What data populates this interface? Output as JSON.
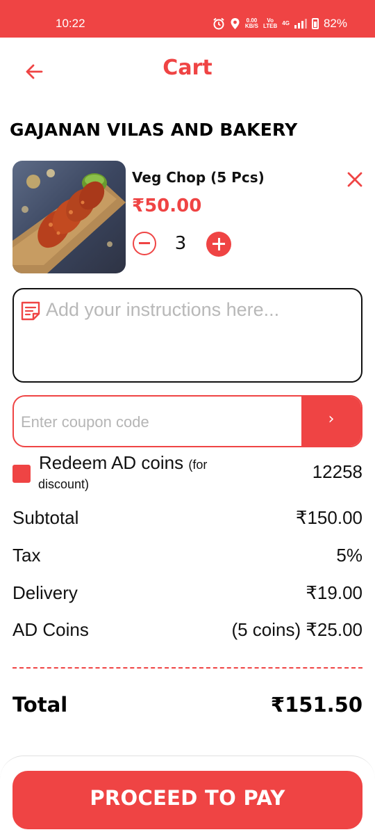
{
  "status_bar": {
    "time": "10:22",
    "net_speed_top": "0.00",
    "net_speed_bottom": "KB/S",
    "volte_top": "Vo",
    "volte_bottom": "LTEB",
    "network": "4G",
    "battery": "82%",
    "icons": [
      "alarm-icon",
      "location-icon",
      "signal-icon",
      "battery-icon"
    ]
  },
  "header": {
    "title": "Cart",
    "back_icon": "arrow-left-icon"
  },
  "restaurant": {
    "name": "GAJANAN VILAS AND BAKERY"
  },
  "cart_item": {
    "name": "Veg Chop (5 Pcs)",
    "price": "₹50.00",
    "quantity": "3",
    "remove_icon": "close-icon",
    "minus_icon": "minus-circle-icon",
    "plus_icon": "plus-circle-icon"
  },
  "instructions": {
    "placeholder": "Add your instructions here...",
    "icon": "note-icon"
  },
  "coupon": {
    "placeholder": "Enter coupon code",
    "button_icon": "chevron-right-icon",
    "button_glyph": "›"
  },
  "redeem": {
    "label": "Redeem AD coins",
    "sub_label_a": "(for",
    "sub_label_b": "discount)",
    "coins": "12258",
    "checked": true
  },
  "summary": {
    "subtotal_label": "Subtotal",
    "subtotal_value": "₹150.00",
    "tax_label": "Tax",
    "tax_value": "5%",
    "delivery_label": "Delivery",
    "delivery_value": "₹19.00",
    "coins_label": "AD Coins",
    "coins_value": "(5 coins) ₹25.00"
  },
  "total": {
    "label": "Total",
    "value": "₹151.50"
  },
  "footer": {
    "pay_button": "PROCEED TO PAY"
  },
  "colors": {
    "accent": "#ef4444",
    "text": "#111111",
    "placeholder": "#b8b8b8"
  }
}
